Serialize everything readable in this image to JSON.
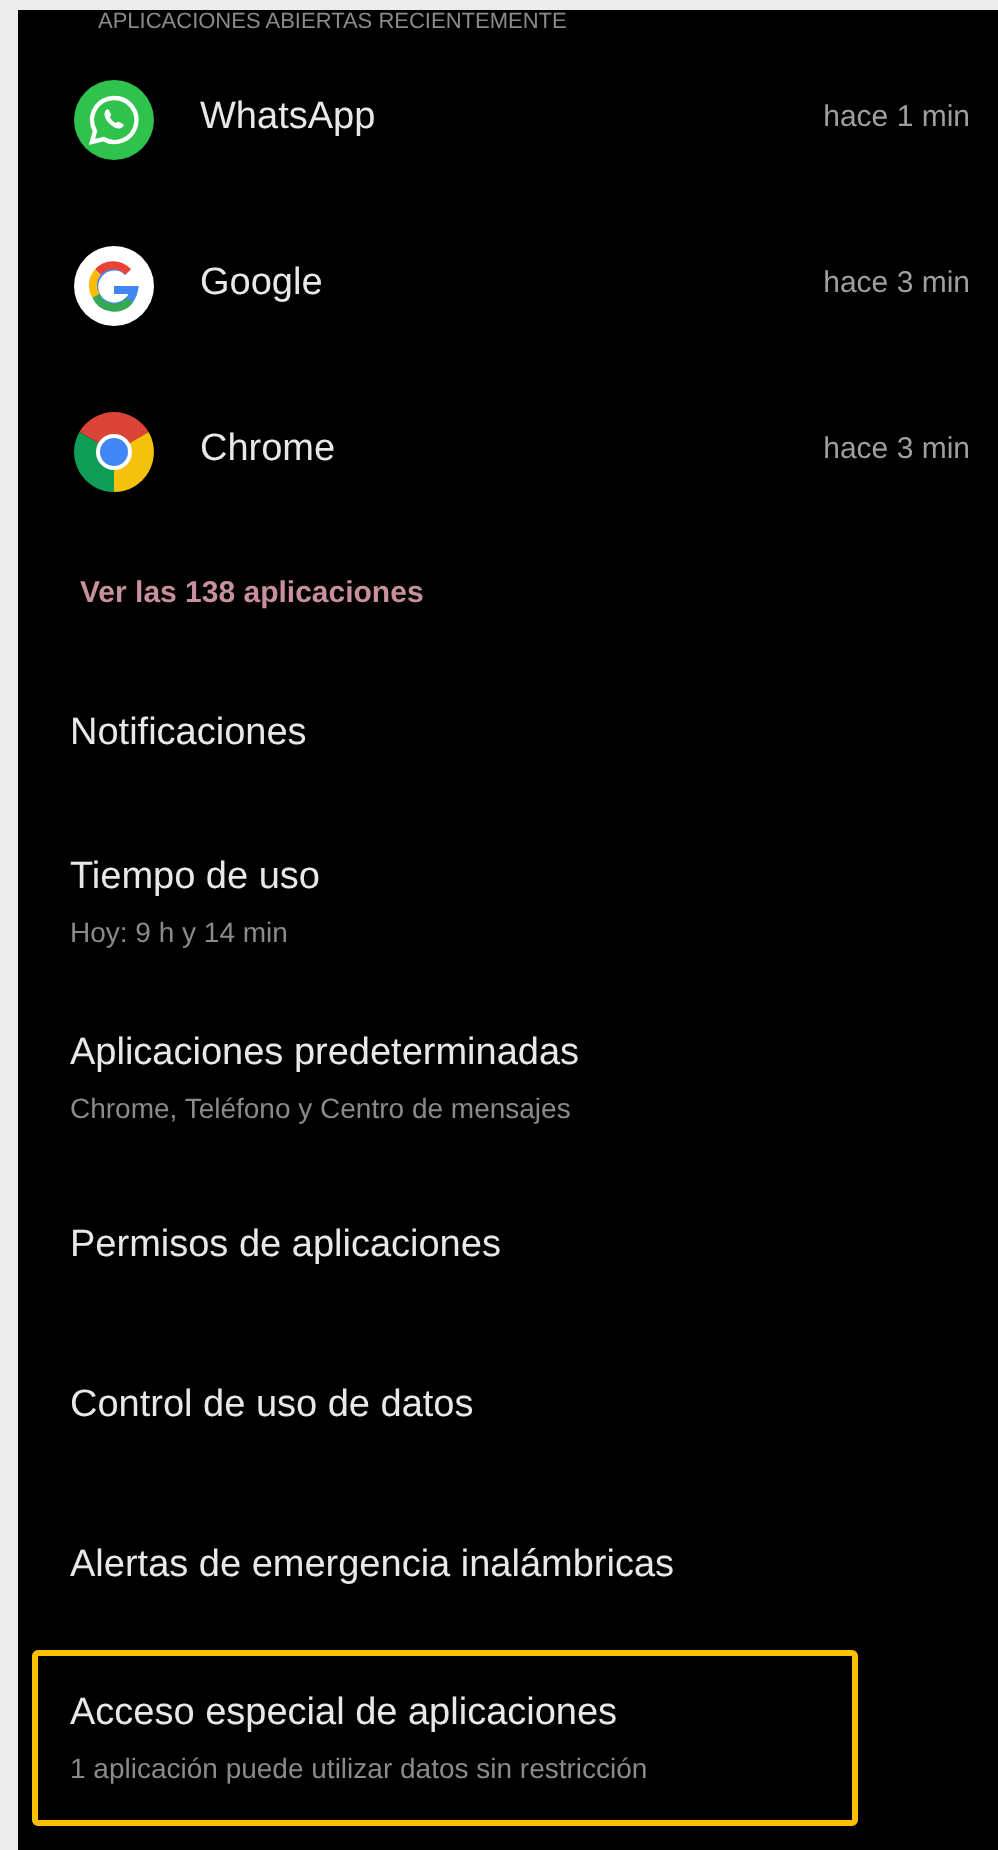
{
  "section_header": "APLICACIONES ABIERTAS RECIENTEMENTE",
  "recent_apps": [
    {
      "kind": "whatsapp",
      "name": "WhatsApp",
      "time": "hace 1 min"
    },
    {
      "kind": "google",
      "name": "Google",
      "time": "hace 3 min"
    },
    {
      "kind": "chrome",
      "name": "Chrome",
      "time": "hace 3 min"
    }
  ],
  "see_all_link": "Ver las 138 aplicaciones",
  "settings": [
    {
      "title": "Notificaciones",
      "highlighted": false
    },
    {
      "title": "Tiempo de uso",
      "subtitle": "Hoy: 9 h y 14 min",
      "highlighted": false
    },
    {
      "title": "Aplicaciones predeterminadas",
      "subtitle": "Chrome, Teléfono y Centro de mensajes",
      "highlighted": false
    },
    {
      "title": "Permisos de aplicaciones",
      "highlighted": false
    },
    {
      "title": "Control de uso de datos",
      "highlighted": false
    },
    {
      "title": "Alertas de emergencia inalámbricas",
      "highlighted": false
    },
    {
      "title": "Acceso especial de aplicaciones",
      "subtitle": "1 aplicación puede utilizar datos sin restricción",
      "highlighted": true
    }
  ]
}
